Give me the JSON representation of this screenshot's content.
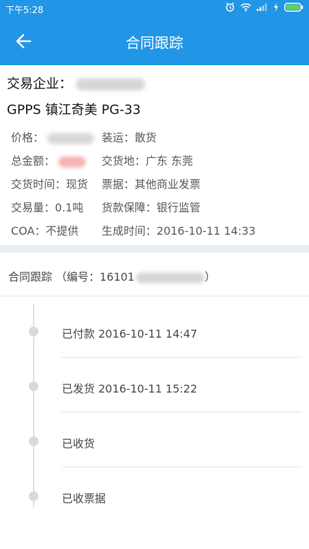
{
  "status_bar": {
    "time": "下午5:28",
    "icons": [
      "alarm-icon",
      "wifi-icon",
      "signal-icon",
      "charging-icon",
      "battery-icon"
    ]
  },
  "app_bar": {
    "back_icon": "arrow-left-icon",
    "title": "合同跟踪"
  },
  "summary": {
    "company_label": "交易企业：",
    "product": "GPPS 镇江奇美 PG-33",
    "price_label": "价格：",
    "shipping_label": "装运：",
    "shipping_value": "散货",
    "total_label": "总金额：",
    "delivery_place_label": "交货地：",
    "delivery_place_value": "广东 东莞",
    "delivery_time_label": "交货时间：",
    "delivery_time_value": "现货",
    "invoice_label": "票据：",
    "invoice_value": "其他商业发票",
    "quantity_label": "交易量：",
    "quantity_value": "0.1吨",
    "payment_guarantee_label": "货款保障：",
    "payment_guarantee_value": "银行监管",
    "coa_label": "COA：",
    "coa_value": "不提供",
    "created_label": "生成时间：",
    "created_value": "2016-10-11 14:33"
  },
  "tracking": {
    "header_prefix": "合同跟踪 （编号：16101",
    "header_suffix": "）",
    "steps": [
      {
        "label": "已付款 2016-10-11 14:47"
      },
      {
        "label": "已发货 2016-10-11 15:22"
      },
      {
        "label": "已收货"
      },
      {
        "label": "已收票据"
      }
    ]
  },
  "colors": {
    "primary": "#2196e6",
    "divider": "#e8eef3",
    "timeline_dot": "#d9d9d9"
  }
}
